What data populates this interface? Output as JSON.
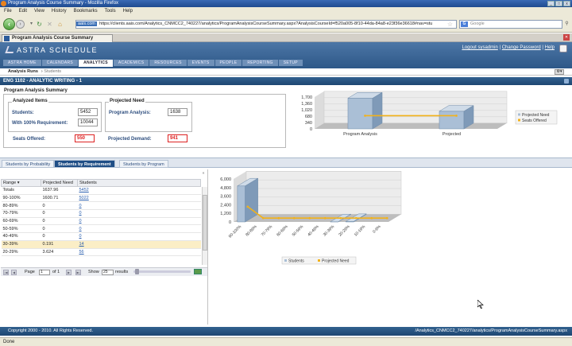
{
  "window": {
    "title": "Program Analysis Course Summary - Mozilla Firefox",
    "controls": [
      "_",
      "□",
      "x"
    ]
  },
  "menu": [
    "File",
    "Edit",
    "View",
    "History",
    "Bookmarks",
    "Tools",
    "Help"
  ],
  "nav": {
    "site_badge": "aais.com",
    "url": "https://clients.aais.com/Analytics_CNMCC2_740227/analytics/ProgramAnalysisCourseSummary.aspx?AnalysisCourseId=f520a005-8f10-44da-84a8-e23f36e36618#nav=stu",
    "search_placeholder": "Google"
  },
  "browser_tab": {
    "label": "Program Analysis Course Summary"
  },
  "app": {
    "brand": "ASTRA SCHEDULE",
    "logout": "Logout sysadmin",
    "change_password": "Change Password",
    "help": "Help",
    "tabs": [
      "ASTRA HOME",
      "CALENDARS",
      "ANALYTICS",
      "ACADEMICS",
      "RESOURCES",
      "EVENTS",
      "PEOPLE",
      "REPORTING",
      "SETUP"
    ],
    "active_tab": "ANALYTICS",
    "subnav": {
      "primary": "Analysis Runs",
      "separator": "›",
      "secondary": "Students"
    }
  },
  "section": {
    "title": "ENG 1102 - ANALYTIC WRITING - 1"
  },
  "summary": {
    "title": "Program Analysis Summary",
    "analyzed_items_label": "Analyzed Items",
    "students_label": "Students:",
    "students_value": "5452",
    "with_req_label": "With 100% Requirement:",
    "with_req_value": "10044",
    "projected_need_label": "Projected Need",
    "program_analysis_label": "Program Analysis:",
    "program_analysis_value": "1638",
    "seats_offered_label": "Seats Offered:",
    "seats_offered_value": "550",
    "projected_demand_label": "Projected Demand:",
    "projected_demand_value": "941"
  },
  "panel_tabs": [
    "Students by Probability",
    "Students by Requirement",
    "Students by Program"
  ],
  "active_panel_tab": "Students by Requirement",
  "grid": {
    "headers": [
      "Range",
      "Projected Need",
      "Students"
    ],
    "sort_indicator": "▾",
    "rows": [
      {
        "range": "Totals",
        "need": "1637.96",
        "students": "5452",
        "highlight": false
      },
      {
        "range": "90-100%",
        "need": "1600.71",
        "students": "5022",
        "highlight": false
      },
      {
        "range": "80-89%",
        "need": "0",
        "students": "0",
        "highlight": false
      },
      {
        "range": "70-79%",
        "need": "0",
        "students": "0",
        "highlight": false
      },
      {
        "range": "60-69%",
        "need": "0",
        "students": "0",
        "highlight": false
      },
      {
        "range": "50-59%",
        "need": "0",
        "students": "0",
        "highlight": false
      },
      {
        "range": "40-49%",
        "need": "0",
        "students": "0",
        "highlight": false
      },
      {
        "range": "30-39%",
        "need": "0.191",
        "students": "14",
        "highlight": true
      },
      {
        "range": "20-29%",
        "need": "3.624",
        "students": "56",
        "highlight": false
      }
    ],
    "pager": {
      "page_label": "Page",
      "page": "1",
      "of_label": "of 1",
      "show_label": "Show",
      "page_size": "25",
      "results_label": "results"
    }
  },
  "chart_data": [
    {
      "type": "bar",
      "categories": [
        "Program Analysis",
        "Projected"
      ],
      "series": [
        {
          "name": "Projected Need",
          "values": [
            1638,
            941
          ],
          "color": "#aabfd6"
        },
        {
          "name": "Seats Offered",
          "values": [
            550,
            550
          ],
          "color": "#f2b21a"
        }
      ],
      "ylim": [
        0,
        1700
      ],
      "yticks": [
        "1,700",
        "1,360",
        "1,020",
        "680",
        "340",
        "0"
      ],
      "legend": "right",
      "grid": true
    },
    {
      "type": "bar",
      "categories": [
        "90-100%",
        "80-89%",
        "70-79%",
        "60-69%",
        "50-59%",
        "40-49%",
        "30-39%",
        "20-29%",
        "10-19%",
        "0-9%"
      ],
      "series": [
        {
          "name": "Students",
          "values": [
            5022,
            0,
            0,
            0,
            0,
            0,
            14,
            56,
            0,
            0
          ],
          "color": "#aabfd6"
        },
        {
          "name": "Projected Need",
          "values": [
            1600.71,
            0,
            0,
            0,
            0,
            0,
            0.191,
            3.624,
            0,
            0
          ],
          "color": "#f2b21a"
        }
      ],
      "ylim": [
        0,
        6000
      ],
      "yticks": [
        "6,000",
        "4,800",
        "3,600",
        "2,400",
        "1,200",
        "0"
      ],
      "legend": "bottom",
      "grid": true
    }
  ],
  "footer": {
    "copyright": "Copyright 2000 - 2010. All Rights Reserved.",
    "path": "/Analytics_CNMCC2_740227/analytics/ProgramAnalysisCourseSummary.aspx"
  },
  "status": "Done"
}
